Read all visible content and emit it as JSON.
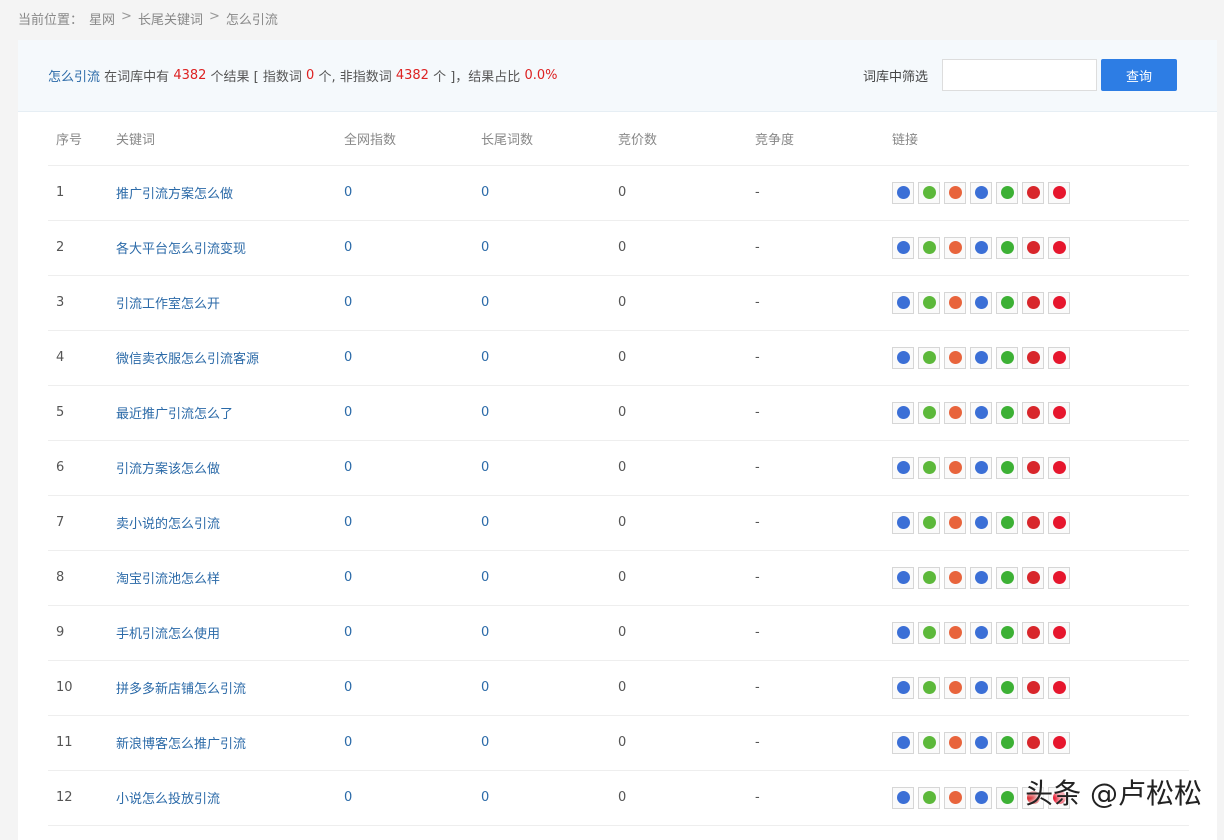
{
  "breadcrumb": {
    "label": "当前位置：",
    "items": [
      "星网",
      "长尾关键词",
      "怎么引流"
    ],
    "sep": ">"
  },
  "summary": {
    "keyword": "怎么引流",
    "text1": "在词库中有",
    "total": "4382",
    "text2": "个结果 [ 指数词",
    "index_count": "0",
    "text3": "个, 非指数词",
    "nonindex_count": "4382",
    "text4": "个 ]，结果占比",
    "ratio": "0.0%"
  },
  "filter": {
    "label": "词库中筛选",
    "input_value": "",
    "button": "查询"
  },
  "table": {
    "headers": [
      "序号",
      "关键词",
      "全网指数",
      "长尾词数",
      "竞价数",
      "竞争度",
      "链接"
    ],
    "rows": [
      {
        "no": "1",
        "keyword": "推广引流方案怎么做",
        "index": "0",
        "longtail": "0",
        "bid": "0",
        "comp": "-"
      },
      {
        "no": "2",
        "keyword": "各大平台怎么引流变现",
        "index": "0",
        "longtail": "0",
        "bid": "0",
        "comp": "-"
      },
      {
        "no": "3",
        "keyword": "引流工作室怎么开",
        "index": "0",
        "longtail": "0",
        "bid": "0",
        "comp": "-"
      },
      {
        "no": "4",
        "keyword": "微信卖衣服怎么引流客源",
        "index": "0",
        "longtail": "0",
        "bid": "0",
        "comp": "-"
      },
      {
        "no": "5",
        "keyword": "最近推广引流怎么了",
        "index": "0",
        "longtail": "0",
        "bid": "0",
        "comp": "-"
      },
      {
        "no": "6",
        "keyword": "引流方案该怎么做",
        "index": "0",
        "longtail": "0",
        "bid": "0",
        "comp": "-"
      },
      {
        "no": "7",
        "keyword": "卖小说的怎么引流",
        "index": "0",
        "longtail": "0",
        "bid": "0",
        "comp": "-"
      },
      {
        "no": "8",
        "keyword": "淘宝引流池怎么样",
        "index": "0",
        "longtail": "0",
        "bid": "0",
        "comp": "-"
      },
      {
        "no": "9",
        "keyword": "手机引流怎么使用",
        "index": "0",
        "longtail": "0",
        "bid": "0",
        "comp": "-"
      },
      {
        "no": "10",
        "keyword": "拼多多新店铺怎么引流",
        "index": "0",
        "longtail": "0",
        "bid": "0",
        "comp": "-"
      },
      {
        "no": "11",
        "keyword": "新浪博客怎么推广引流",
        "index": "0",
        "longtail": "0",
        "bid": "0",
        "comp": "-"
      },
      {
        "no": "12",
        "keyword": "小说怎么投放引流",
        "index": "0",
        "longtail": "0",
        "bid": "0",
        "comp": "-"
      }
    ],
    "link_icons": [
      {
        "name": "baidu-icon",
        "color": "#3b6fd6"
      },
      {
        "name": "360-icon",
        "color": "#5cb83a"
      },
      {
        "name": "sogou-icon",
        "color": "#e8643c"
      },
      {
        "name": "baidu-mobile-icon",
        "color": "#3b6fd6"
      },
      {
        "name": "wechat-icon",
        "color": "#3cb034"
      },
      {
        "name": "toutiao-icon",
        "color": "#d8262b"
      },
      {
        "name": "weibo-icon",
        "color": "#e6162d"
      }
    ]
  },
  "watermark": "头条 @卢松松",
  "colors": {
    "accent": "#2d7de4",
    "link": "#2b6aa8",
    "highlight": "#d22"
  }
}
